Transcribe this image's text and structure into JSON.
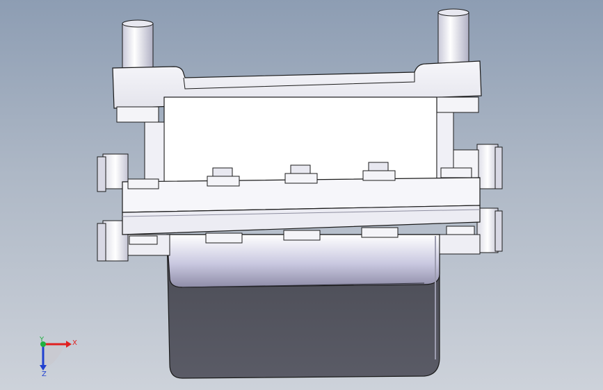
{
  "viewport": {
    "background_top": "#8d9db3",
    "background_bottom": "#cdd2da"
  },
  "model": {
    "description_icon": "heat-exchanger-plate-assembly",
    "body_color": "#f2f2f6",
    "shadow_color": "#55565f",
    "edge_color": "#1a1a1a"
  },
  "triad": {
    "x_label": "X",
    "y_label": "Y",
    "z_label": "Z",
    "x_color": "#e02020",
    "y_color": "#20b040",
    "z_color": "#2040d0"
  }
}
